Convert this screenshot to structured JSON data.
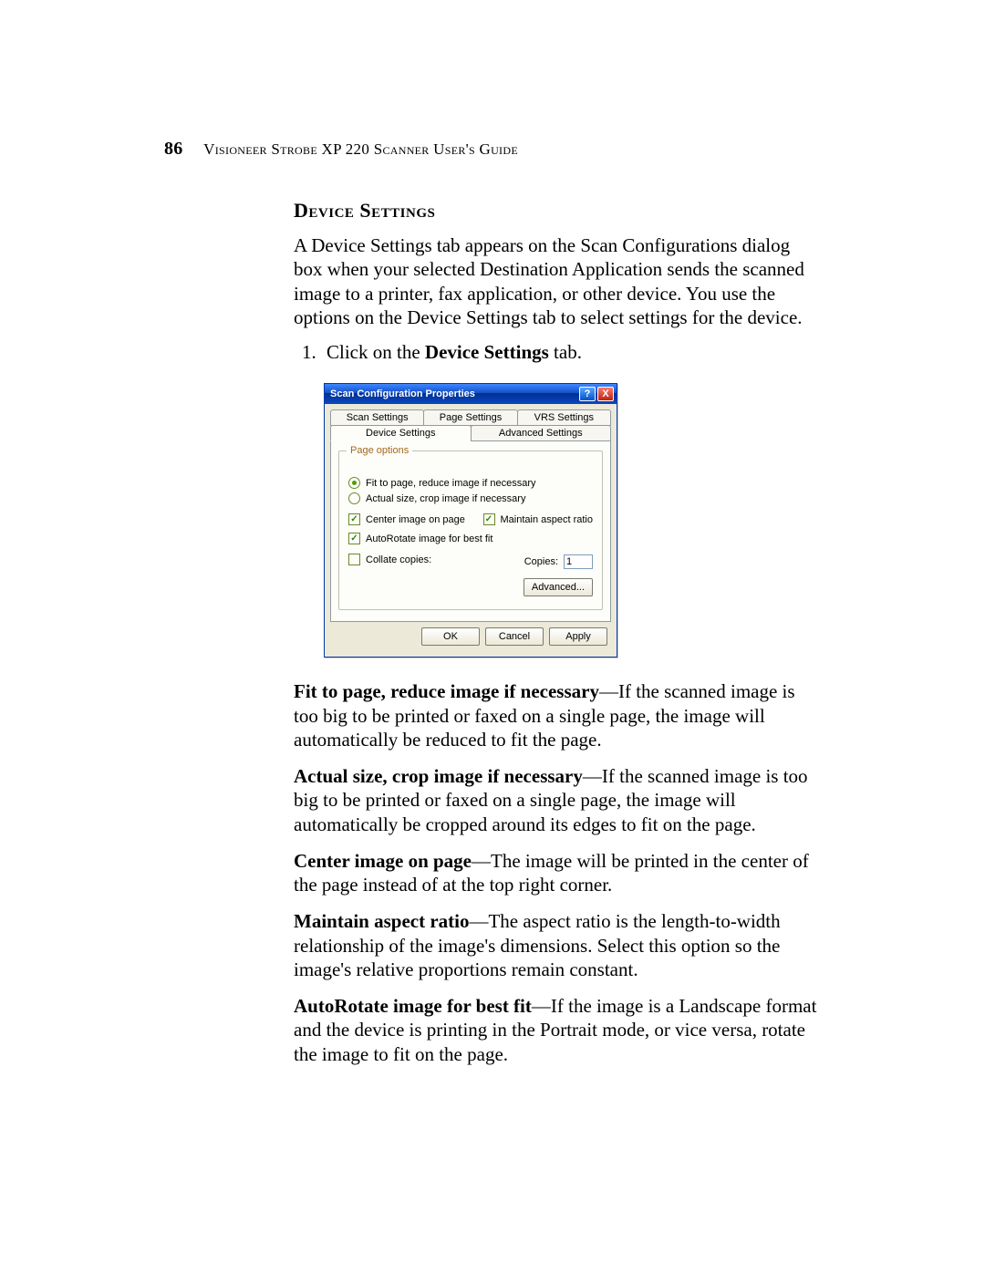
{
  "header": {
    "page_number": "86",
    "running_title": "Visioneer Strobe XP 220 Scanner User's Guide"
  },
  "section": {
    "title": "Device Settings",
    "intro": "A Device Settings tab appears on the Scan Configurations dialog box when your selected Destination Application sends the scanned image to a printer, fax application, or other device. You use the options on the Device Settings tab to select settings for the device.",
    "step1_prefix": "Click on the ",
    "step1_bold": "Device Settings",
    "step1_suffix": " tab."
  },
  "dialog": {
    "title": "Scan Configuration Properties",
    "help_glyph": "?",
    "close_glyph": "X",
    "tabs_row1": {
      "scan": "Scan Settings",
      "page": "Page Settings",
      "vrs": "VRS Settings"
    },
    "tabs_row2": {
      "device": "Device Settings",
      "advanced": "Advanced Settings"
    },
    "group_legend": "Page options",
    "radio_fit": "Fit to page, reduce image if necessary",
    "radio_actual": "Actual size, crop image if necessary",
    "check_center": "Center image on page",
    "check_aspect": "Maintain aspect ratio",
    "check_autorotate": "AutoRotate image for best fit",
    "check_collate": "Collate copies:",
    "copies_label": "Copies:",
    "copies_value": "1",
    "btn_advanced": "Advanced...",
    "btn_ok": "OK",
    "btn_cancel": "Cancel",
    "btn_apply": "Apply"
  },
  "descriptions": {
    "fit_b": "Fit to page, reduce image if necessary",
    "fit_t": "—If the scanned image is too big to be printed or faxed on a single page, the image will automatically be reduced to fit the page.",
    "actual_b": "Actual size, crop image if necessary",
    "actual_t": "—If the scanned image is too big to be printed or faxed on a single page, the image will automatically be cropped around its edges to fit on the page.",
    "center_b": "Center image on page",
    "center_t": "—The image will be printed in the center of the page instead of at the top right corner.",
    "aspect_b": "Maintain aspect ratio",
    "aspect_t": "—The aspect ratio is the length-to-width relationship of the image's dimensions. Select this option so the image's relative proportions remain constant.",
    "rotate_b": "AutoRotate image for best fit",
    "rotate_t": "—If the image is a Landscape format and the device is printing in the Portrait mode, or vice versa, rotate the image to fit on the page."
  }
}
